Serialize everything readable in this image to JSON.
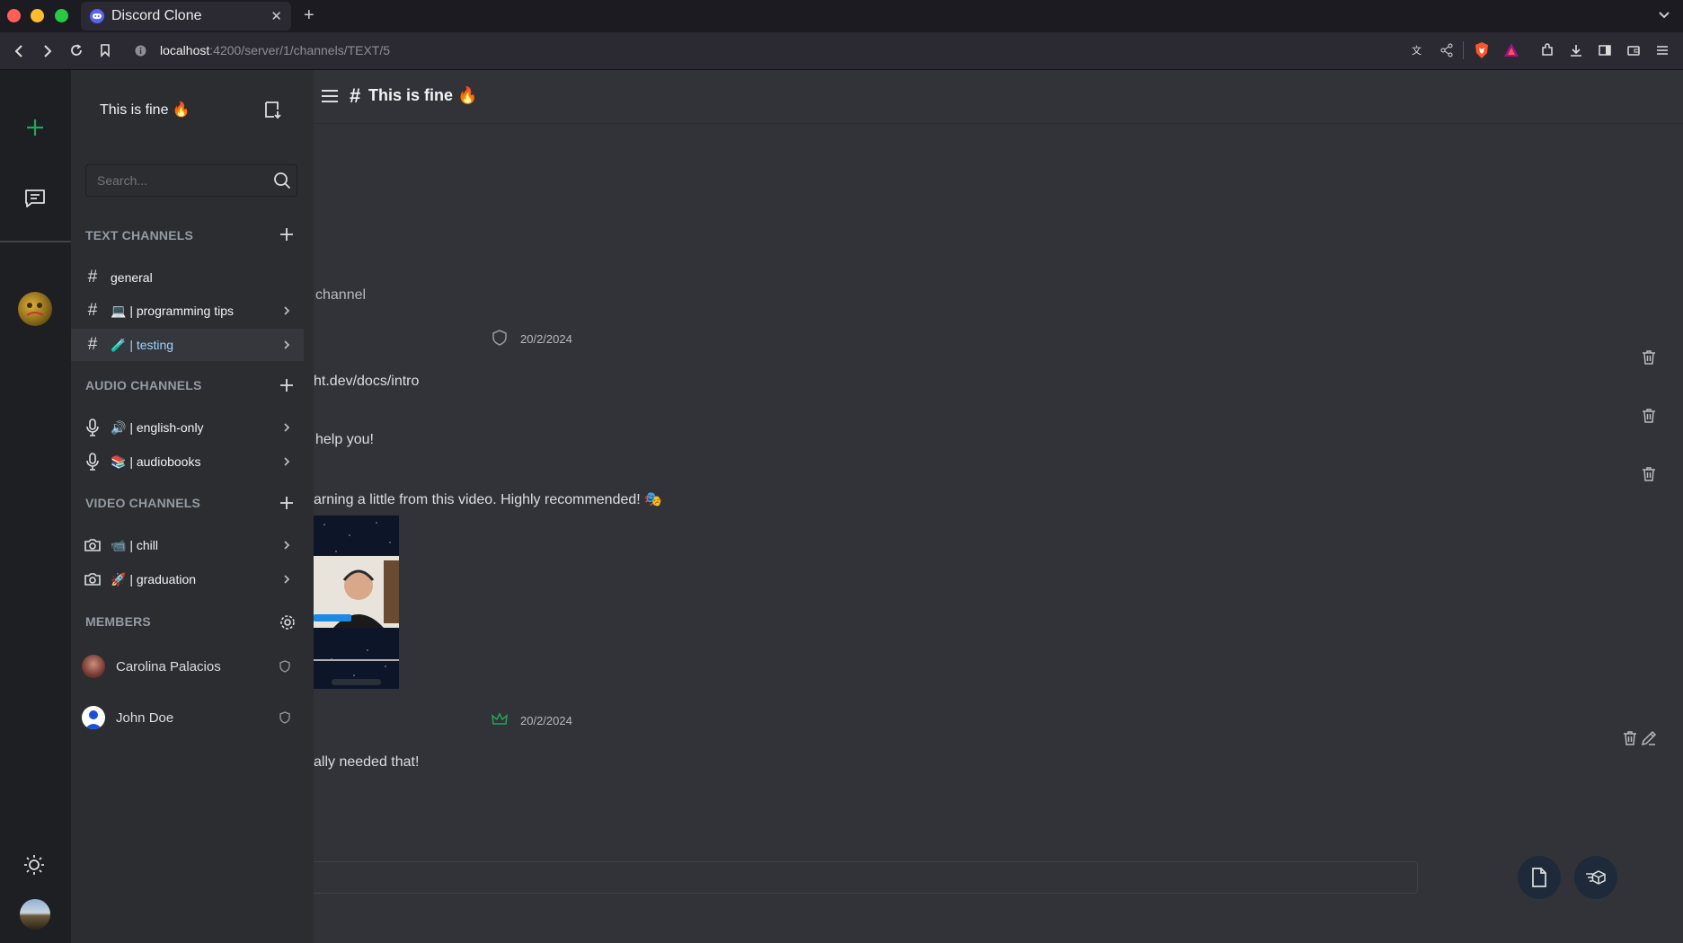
{
  "browser": {
    "tab_title": "Discord Clone",
    "url_host": "localhost",
    "url_path": ":4200/server/1/channels/TEXT/5"
  },
  "server": {
    "name": "This is fine 🔥",
    "search_placeholder": "Search..."
  },
  "sections": {
    "text": "TEXT CHANNELS",
    "audio": "AUDIO CHANNELS",
    "video": "VIDEO CHANNELS",
    "members": "MEMBERS"
  },
  "channels": {
    "text": [
      {
        "label": "general"
      },
      {
        "label": "💻 | programming tips"
      },
      {
        "label": "🧪 | testing"
      }
    ],
    "audio": [
      {
        "label": "🔊 | english-only"
      },
      {
        "label": "📚 | audiobooks"
      }
    ],
    "video": [
      {
        "label": "📹 | chill"
      },
      {
        "label": "🚀 | graduation"
      }
    ]
  },
  "members": [
    {
      "name": "Carolina Palacios"
    },
    {
      "name": "John Doe"
    }
  ],
  "header": {
    "hash": "#",
    "channel_title": "This is fine 🔥"
  },
  "chat": {
    "intro_fragment": "channel",
    "messages": [
      {
        "date": "20/2/2024",
        "lines": [
          "ht.dev/docs/intro",
          "help you!",
          "arning a little from this video. Highly recommended! 🎭"
        ]
      },
      {
        "date": "20/2/2024",
        "lines": [
          "ally needed that!"
        ]
      }
    ]
  },
  "colors": {
    "accent": "#5865f2",
    "green": "#23a559",
    "active_channel_bg": "#35373c",
    "active_channel_text": "#9bd4ff"
  }
}
